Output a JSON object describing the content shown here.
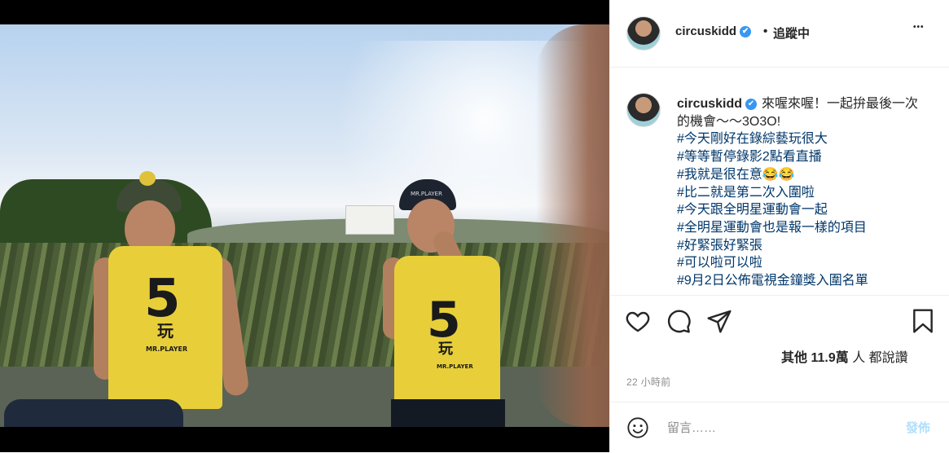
{
  "post": {
    "username": "circuskidd",
    "verified_mark": "✔",
    "dot": "•",
    "follow_status": "追蹤中",
    "more": "•••"
  },
  "caption": {
    "username": "circuskidd",
    "verified_mark": "✔",
    "text": "來喔來喔！一起拚最後一次的機會～～3O3O!",
    "hashtags": [
      "#今天剛好在錄綜藝玩很大",
      "#等等暫停錄影2點看直播",
      "#我就是很在意😂😂",
      "#比二就是第二次入圍啦",
      "#今天跟全明星運動會一起",
      "#全明星運動會也是報一樣的項目",
      "#好緊張好緊張",
      "#可以啦可以啦",
      "#9月2日公佈電視金鐘獎入圍名單"
    ]
  },
  "likes": {
    "prefix": "其他",
    "count": "11.9萬",
    "suffix": "人 都說讚"
  },
  "timestamp": "22 小時前",
  "comment": {
    "placeholder": "留言……",
    "post_label": "發佈"
  },
  "photo_text": {
    "shirt_number": "5",
    "shirt_glyph": "玩",
    "shirt_brand": "MR.PLAYER",
    "cap_text": "MR.PLAYER"
  },
  "icons": {
    "like": "heart-icon",
    "comment": "comment-icon",
    "share": "share-icon",
    "save": "bookmark-icon",
    "emoji": "emoji-icon"
  },
  "colors": {
    "link": "#00376b",
    "verified": "#3897f0",
    "post_button": "#b2dffc",
    "muted": "#8e8e8e"
  }
}
